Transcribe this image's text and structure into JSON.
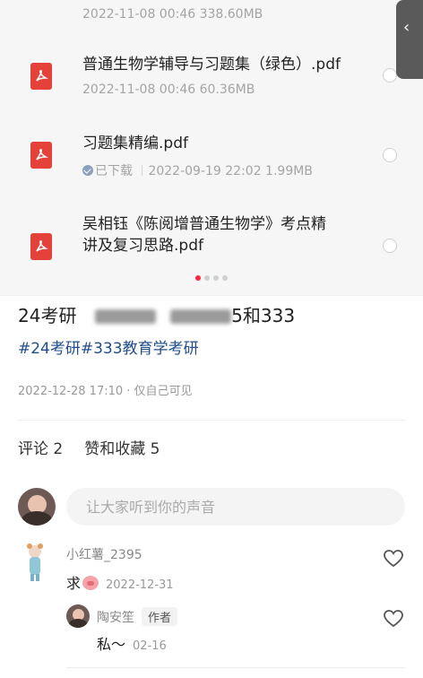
{
  "files": [
    {
      "name": "",
      "date": "2022-11-08",
      "time": "00:46",
      "size": "338.60MB",
      "downloaded": false
    },
    {
      "name": "普通生物学辅导与习题集（绿色）.pdf",
      "date": "2022-11-08",
      "time": "00:46",
      "size": "60.36MB",
      "downloaded": false
    },
    {
      "name": "习题集精编.pdf",
      "date": "2022-09-19",
      "time": "22:02",
      "size": "1.99MB",
      "downloaded": true,
      "downloaded_label": "已下载"
    },
    {
      "name_line1": "吴相钰《陈阅增普通生物学》考点精",
      "name_line2": "讲及复习思路.pdf"
    }
  ],
  "file_meta_0": "2022-11-08  00:46  338.60MB",
  "file_meta_1": "2022-11-08  00:46  60.36MB",
  "file_meta_2": "2022-09-19  22:02  1.99MB",
  "pager": {
    "total": 4,
    "active": 1
  },
  "side_tab_icon": "chevron-left-icon",
  "post": {
    "title_prefix": "24考研",
    "title_suffix": "5和333",
    "tags": "#24考研#333教育学考研",
    "meta": "2022-12-28 17:10 · 仅自己可见"
  },
  "counts": {
    "comments": "评论 2",
    "likes": "赞和收藏 5"
  },
  "comment_input": {
    "placeholder": "让大家听到你的声音"
  },
  "comments": [
    {
      "user": "小红薯_2395",
      "text": "求",
      "date": "2022-12-31"
    },
    {
      "user": "陶安笙",
      "badge": "作者",
      "text": "私～",
      "date": "02-16"
    }
  ],
  "colors": {
    "accent": "#ff2442",
    "tag": "#1f4d8f",
    "pdf": "#e5413b"
  }
}
